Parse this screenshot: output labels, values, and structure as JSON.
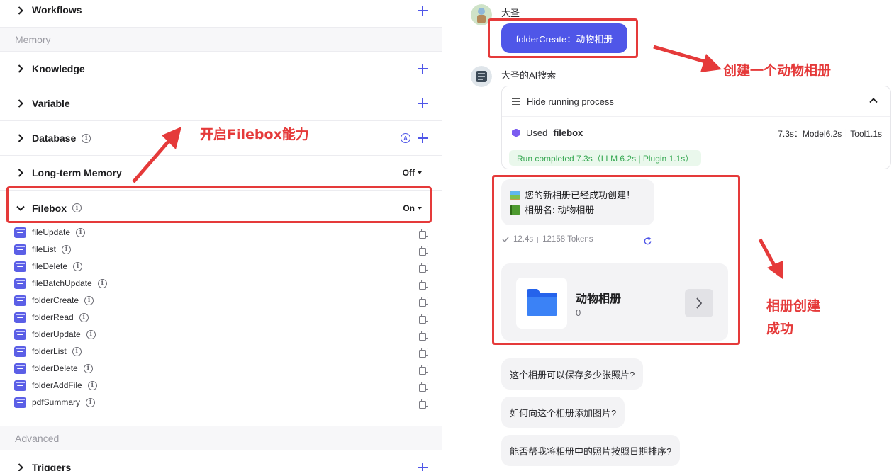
{
  "left_panel": {
    "sections_top": [
      {
        "label": "Workflows"
      }
    ],
    "groups": {
      "memory": "Memory",
      "advanced": "Advanced"
    },
    "knowledge": {
      "label": "Knowledge"
    },
    "variable": {
      "label": "Variable"
    },
    "database": {
      "label": "Database",
      "auto_badge": "A"
    },
    "long_term_memory": {
      "label": "Long-term Memory",
      "toggle": "Off"
    },
    "filebox": {
      "label": "Filebox",
      "toggle": "On"
    },
    "tools": [
      {
        "label": "fileUpdate"
      },
      {
        "label": "fileList"
      },
      {
        "label": "fileDelete"
      },
      {
        "label": "fileBatchUpdate"
      },
      {
        "label": "folderCreate"
      },
      {
        "label": "folderRead"
      },
      {
        "label": "folderUpdate"
      },
      {
        "label": "folderList"
      },
      {
        "label": "folderDelete"
      },
      {
        "label": "folderAddFile"
      },
      {
        "label": "pdfSummary"
      }
    ],
    "triggers": {
      "label": "Triggers"
    },
    "info_glyph": "i"
  },
  "annotations": {
    "enable_filebox": "开启Filebox能力",
    "create_album": "创建一个动物相册",
    "album_success_line1": "相册创建",
    "album_success_line2": "成功"
  },
  "chat": {
    "user_name": "大圣",
    "user_message": "folderCreate：动物相册",
    "bot_name": "大圣的AI搜索",
    "process": {
      "toggle_label": "Hide running process",
      "used_prefix": "Used",
      "used_tool": "filebox",
      "timing": "7.3s：Model6.2s｜Tool1.1s",
      "run_status": "Run completed 7.3s（LLM 6.2s | Plugin 1.1s）"
    },
    "reply_line1": "您的新相册已经成功创建！",
    "reply_line2": "相册名: 动物相册",
    "meta_time": "12.4s",
    "meta_tokens": "12158 Tokens",
    "folder_card": {
      "title": "动物相册",
      "count": "0"
    },
    "suggestions": [
      "这个相册可以保存多少张照片?",
      "如何向这个相册添加图片?",
      "能否帮我将相册中的照片按照日期排序?"
    ]
  },
  "colors": {
    "accent": "#4f56e8",
    "annotation_red": "#e53a3a",
    "success_green": "#36a852",
    "folder_blue": "#2563eb"
  }
}
